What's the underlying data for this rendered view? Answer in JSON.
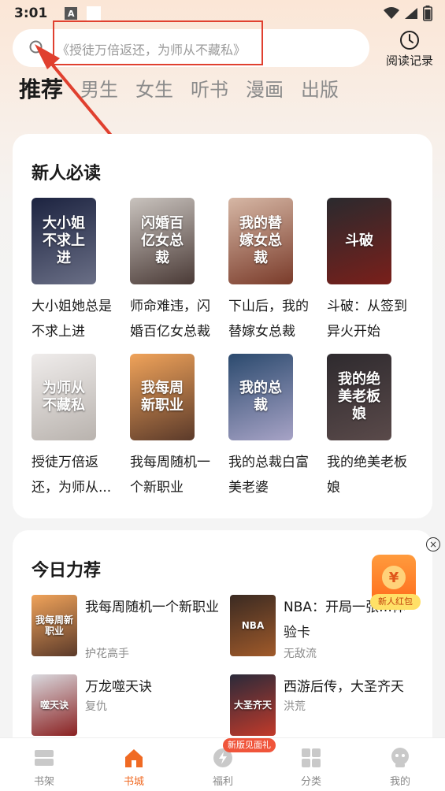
{
  "status_bar": {
    "time": "3:01",
    "notification_letter": "A"
  },
  "search": {
    "placeholder": "《授徒万倍返还，为师从不藏私》"
  },
  "history": {
    "label": "阅读记录"
  },
  "tabs": [
    {
      "label": "推荐",
      "active": true
    },
    {
      "label": "男生",
      "active": false
    },
    {
      "label": "女生",
      "active": false
    },
    {
      "label": "听书",
      "active": false
    },
    {
      "label": "漫画",
      "active": false
    },
    {
      "label": "出版",
      "active": false
    }
  ],
  "new_reader": {
    "title": "新人必读",
    "books": [
      {
        "title": "大小姐她总是不求上进",
        "cover_text": "大小姐不求上进",
        "cover_colors": [
          "#1c2340",
          "#6a6f86"
        ]
      },
      {
        "title": "师命难违，闪婚百亿女总裁",
        "cover_text": "闪婚百亿女总裁",
        "cover_colors": [
          "#c9c3be",
          "#4a3a36"
        ]
      },
      {
        "title": "下山后，我的替嫁女总裁",
        "cover_text": "我的替嫁女总裁",
        "cover_colors": [
          "#d6b7a5",
          "#7a3b2a"
        ]
      },
      {
        "title": "斗破：从签到异火开始",
        "cover_text": "斗破",
        "cover_colors": [
          "#2a2a2e",
          "#7a1f1a"
        ]
      },
      {
        "title": "授徒万倍返还，为师从...",
        "cover_text": "为师从不藏私",
        "cover_colors": [
          "#efeceb",
          "#b9b3ae"
        ]
      },
      {
        "title": "我每周随机一个新职业",
        "cover_text": "我每周新职业",
        "cover_colors": [
          "#f0a35a",
          "#5b3a2a"
        ]
      },
      {
        "title": "我的总裁白富美老婆",
        "cover_text": "我的总裁",
        "cover_colors": [
          "#2b4a6e",
          "#a7a3c6"
        ]
      },
      {
        "title": "我的绝美老板娘",
        "cover_text": "我的绝美老板娘",
        "cover_colors": [
          "#2e2a2e",
          "#5a4a4a"
        ]
      }
    ]
  },
  "today": {
    "title": "今日力荐",
    "items": [
      {
        "title": "我每周随机一个新职业",
        "author": "护花高手",
        "cover_text": "我每周新职业",
        "cover_colors": [
          "#f0a35a",
          "#5b3a2a"
        ]
      },
      {
        "title": "NBA：开局一张…体验卡",
        "author": "无敌流",
        "cover_text": "NBA",
        "cover_colors": [
          "#3a2a22",
          "#a05a2a"
        ]
      },
      {
        "title": "万龙噬天诀",
        "author": "复仇",
        "cover_text": "噬天诀",
        "cover_colors": [
          "#d9d9de",
          "#8a2020"
        ]
      },
      {
        "title": "西游后传，大圣齐天",
        "author": "洪荒",
        "cover_text": "大圣齐天",
        "cover_colors": [
          "#2a2a3a",
          "#c23a2a"
        ]
      }
    ]
  },
  "ad": {
    "close_glyph": "×",
    "yen": "¥",
    "label": "新人红包"
  },
  "bottom_nav": {
    "badge": "新版见面礼",
    "items": [
      {
        "label": "书架",
        "active": false
      },
      {
        "label": "书城",
        "active": true
      },
      {
        "label": "福利",
        "active": false
      },
      {
        "label": "分类",
        "active": false
      },
      {
        "label": "我的",
        "active": false
      }
    ]
  },
  "colors": {
    "accent": "#f06a23",
    "highlight_border": "#e0402f",
    "arrow": "#e0402f"
  }
}
